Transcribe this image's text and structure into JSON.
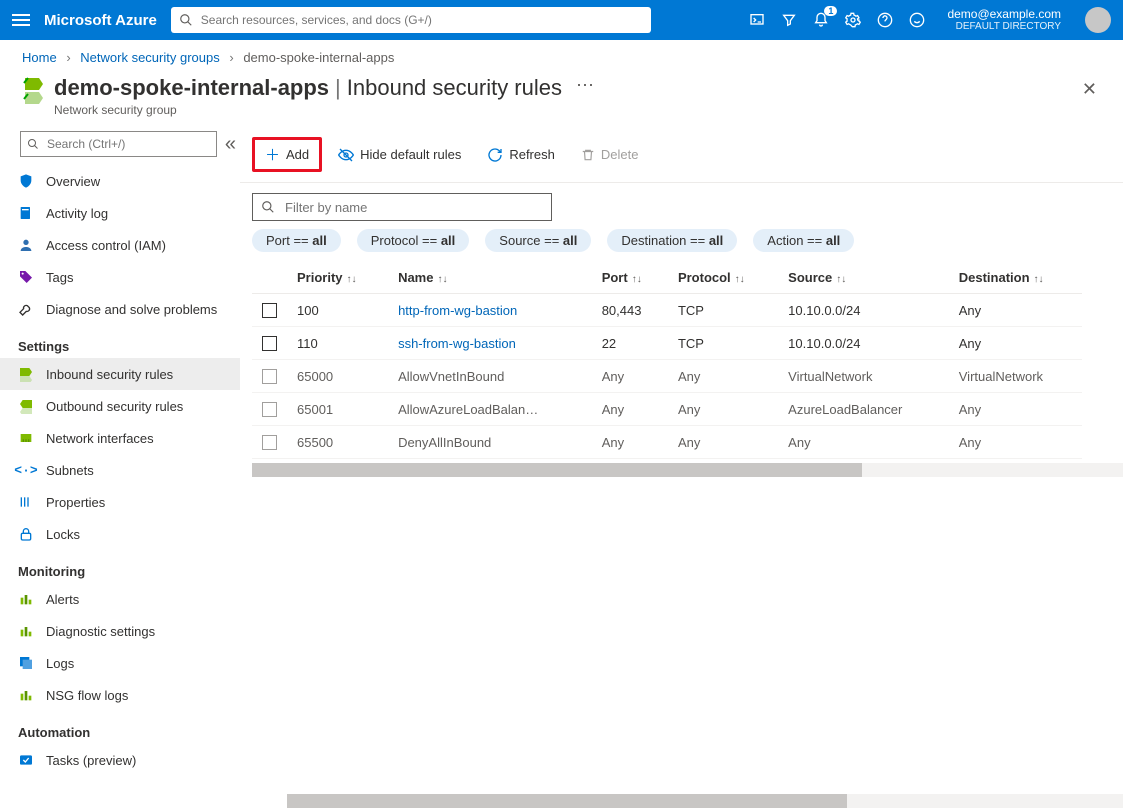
{
  "header": {
    "brand": "Microsoft Azure",
    "search_placeholder": "Search resources, services, and docs (G+/)",
    "notifications_count": "1",
    "account_email": "demo@example.com",
    "account_directory": "DEFAULT DIRECTORY"
  },
  "breadcrumb": {
    "items": [
      "Home",
      "Network security groups",
      "demo-spoke-internal-apps"
    ]
  },
  "page": {
    "resource_name": "demo-spoke-internal-apps",
    "section_title": "Inbound security rules",
    "resource_type": "Network security group"
  },
  "sidebar": {
    "search_placeholder": "Search (Ctrl+/)",
    "top_items": [
      {
        "label": "Overview",
        "icon": "shield"
      },
      {
        "label": "Activity log",
        "icon": "book"
      },
      {
        "label": "Access control (IAM)",
        "icon": "person"
      },
      {
        "label": "Tags",
        "icon": "tag"
      },
      {
        "label": "Diagnose and solve problems",
        "icon": "wrench"
      }
    ],
    "groups": [
      {
        "title": "Settings",
        "items": [
          {
            "label": "Inbound security rules",
            "icon": "inbound",
            "selected": true
          },
          {
            "label": "Outbound security rules",
            "icon": "outbound"
          },
          {
            "label": "Network interfaces",
            "icon": "nic"
          },
          {
            "label": "Subnets",
            "icon": "subnet"
          },
          {
            "label": "Properties",
            "icon": "properties"
          },
          {
            "label": "Locks",
            "icon": "lock"
          }
        ]
      },
      {
        "title": "Monitoring",
        "items": [
          {
            "label": "Alerts",
            "icon": "chart"
          },
          {
            "label": "Diagnostic settings",
            "icon": "chart"
          },
          {
            "label": "Logs",
            "icon": "logs"
          },
          {
            "label": "NSG flow logs",
            "icon": "chart"
          }
        ]
      },
      {
        "title": "Automation",
        "items": [
          {
            "label": "Tasks (preview)",
            "icon": "tasks"
          }
        ]
      }
    ]
  },
  "toolbar": {
    "add": "Add",
    "hide_default": "Hide default rules",
    "refresh": "Refresh",
    "delete": "Delete"
  },
  "filter": {
    "placeholder": "Filter by name",
    "pills": [
      {
        "key": "Port",
        "value": "all"
      },
      {
        "key": "Protocol",
        "value": "all"
      },
      {
        "key": "Source",
        "value": "all"
      },
      {
        "key": "Destination",
        "value": "all"
      },
      {
        "key": "Action",
        "value": "all"
      }
    ]
  },
  "table": {
    "columns": [
      "Priority",
      "Name",
      "Port",
      "Protocol",
      "Source",
      "Destination"
    ],
    "rows": [
      {
        "priority": "100",
        "name": "http-from-wg-bastion",
        "port": "80,443",
        "protocol": "TCP",
        "source": "10.10.0.0/24",
        "destination": "Any",
        "default": false
      },
      {
        "priority": "110",
        "name": "ssh-from-wg-bastion",
        "port": "22",
        "protocol": "TCP",
        "source": "10.10.0.0/24",
        "destination": "Any",
        "default": false
      },
      {
        "priority": "65000",
        "name": "AllowVnetInBound",
        "port": "Any",
        "protocol": "Any",
        "source": "VirtualNetwork",
        "destination": "VirtualNetwork",
        "default": true
      },
      {
        "priority": "65001",
        "name": "AllowAzureLoadBalan…",
        "port": "Any",
        "protocol": "Any",
        "source": "AzureLoadBalancer",
        "destination": "Any",
        "default": true
      },
      {
        "priority": "65500",
        "name": "DenyAllInBound",
        "port": "Any",
        "protocol": "Any",
        "source": "Any",
        "destination": "Any",
        "default": true
      }
    ]
  }
}
